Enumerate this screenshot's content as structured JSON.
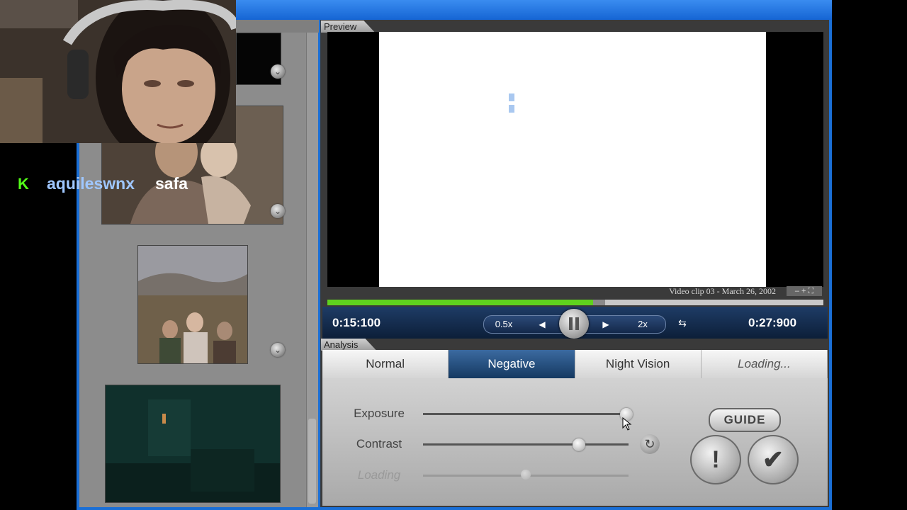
{
  "preview": {
    "section_label": "Preview",
    "clip_caption": "Video clip 03 - March 26, 2002",
    "mini_controls": "– + ⛶",
    "progress_fraction": 0.535,
    "buffer_fraction": 0.56,
    "current_time": "0:15:100",
    "total_time": "0:27:900",
    "transport": {
      "slow_label": "0.5x",
      "prev_icon": "◀",
      "next_icon": "▶",
      "fast_label": "2x",
      "loop_icon": "⇆"
    }
  },
  "analysis": {
    "section_label": "Analysis",
    "modes": [
      {
        "label": "Normal",
        "state": "default"
      },
      {
        "label": "Negative",
        "state": "active"
      },
      {
        "label": "Night Vision",
        "state": "default"
      },
      {
        "label": "Loading...",
        "state": "loading"
      }
    ],
    "sliders": [
      {
        "label": "Exposure",
        "value": 0.99,
        "enabled": true
      },
      {
        "label": "Contrast",
        "value": 0.76,
        "enabled": true
      },
      {
        "label": "Loading",
        "value": 0.5,
        "enabled": false
      }
    ],
    "reset_icon": "↻",
    "guide_label": "GUIDE",
    "alert_icon": "!",
    "confirm_icon": "✔"
  },
  "thumbnails": [
    {
      "name": "dark-clip",
      "check_icon": "⌄"
    },
    {
      "name": "man-with-baby",
      "check_icon": "⌄"
    },
    {
      "name": "family-outdoors",
      "check_icon": "⌄"
    },
    {
      "name": "dark-room",
      "check_icon": ""
    }
  ],
  "overlay": {
    "platform_icon": "K",
    "chat_username": "aquileswnx",
    "chat_message": "safa"
  },
  "colors": {
    "accent_blue": "#1a6fd6",
    "active_tab": "#1f4a7c",
    "progress_green": "#5fd21e",
    "kick_green": "#53fc18"
  }
}
